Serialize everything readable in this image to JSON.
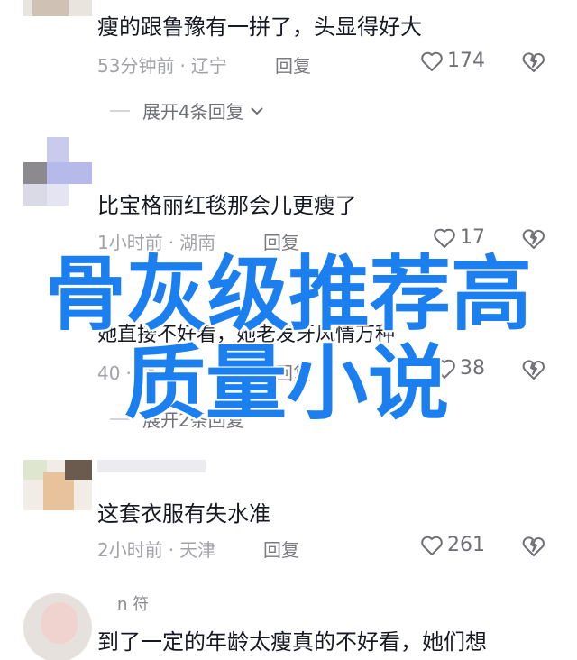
{
  "comments": [
    {
      "text": "瘦的跟鲁豫有一拼了，头显得好大",
      "time": "53分钟前",
      "location": "辽宁",
      "reply_label": "回复",
      "likes": "174",
      "expand_label": "展开4条回复"
    },
    {
      "text": "比宝格丽红毯那会儿更瘦了",
      "time": "1小时前",
      "location": "湖南",
      "reply_label": "回复",
      "likes": "17"
    },
    {
      "text": "她直接不好看，她老发牙风情万种",
      "time": "40",
      "location": "湖",
      "reply_label": "回复",
      "likes": "38",
      "expand_label": "展开2条回复"
    },
    {
      "text": "这套衣服有失水准",
      "time": "2小时前",
      "location": "天津",
      "reply_label": "回复",
      "likes": "261"
    },
    {
      "username": "n 符",
      "text": "到了一定的年龄太瘦真的不好看，她们想"
    }
  ],
  "overlay": {
    "line1": "骨灰级推荐高",
    "line2": "质量小说",
    "color": "#1b7ff0"
  },
  "icons": {
    "like": "heart-outline-icon",
    "dislike": "broken-heart-icon",
    "expand": "chevron-down-icon"
  }
}
